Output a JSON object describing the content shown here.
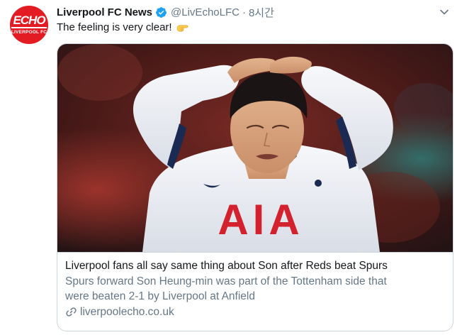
{
  "account": {
    "avatar_text": "ECHO",
    "avatar_subtext": "LIVERPOOL FC",
    "display_name": "Liverpool FC News",
    "handle": "@LivEchoLFC",
    "separator": "·",
    "timestamp": "8시간"
  },
  "tweet": {
    "text": "The feeling is very clear!",
    "emoji": "hand-pointing-emoji"
  },
  "card": {
    "image_alt": "Son Heung-min holding his head in a white Tottenham shirt with AIA sponsor",
    "shirt_sponsor": "AIA",
    "title": "Liverpool fans all say same thing about Son after Reds beat Spurs",
    "description_line1": "Spurs forward Son Heung-min was part of the Tottenham side that",
    "description_line2": "were beaten 2-1 by Liverpool at Anfield",
    "domain": "liverpoolecho.co.uk"
  },
  "colors": {
    "brand_red": "#e31b23",
    "verified_blue": "#1da1f2",
    "secondary_text": "#657786",
    "border": "#ccd6dd"
  }
}
